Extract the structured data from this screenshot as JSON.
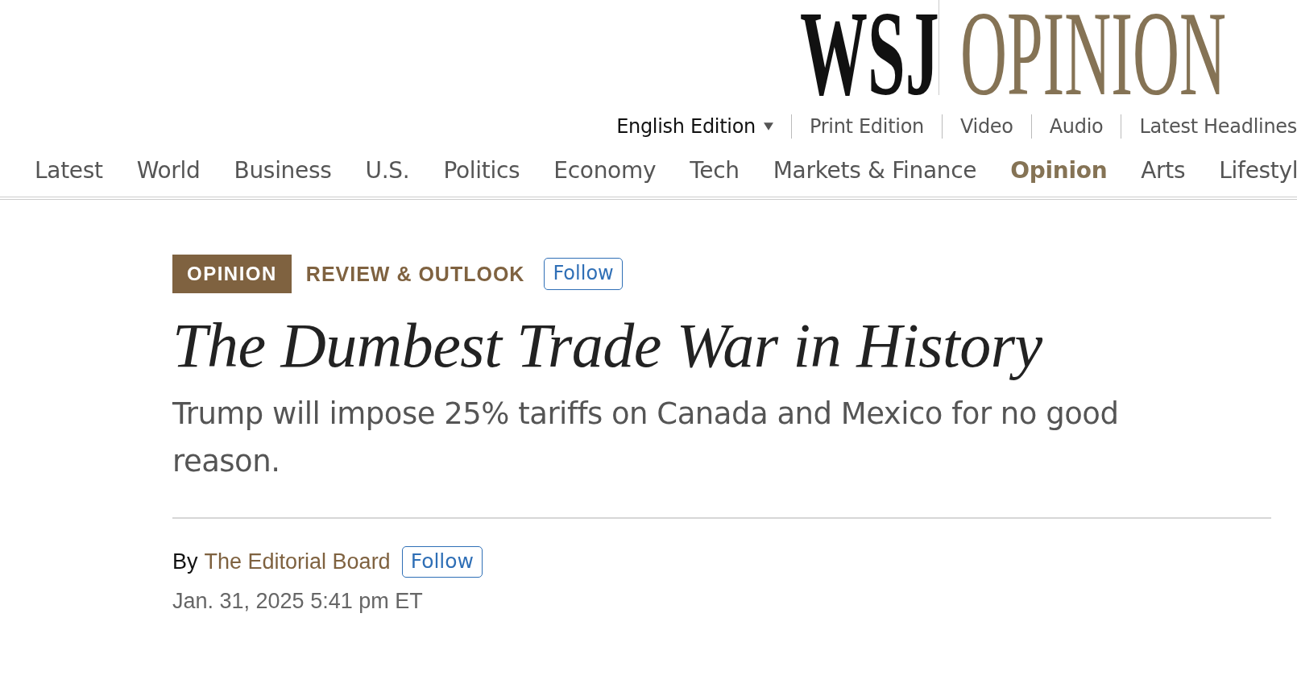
{
  "masthead": {
    "brand": "WSJ",
    "section": "OPINION"
  },
  "edition_links": [
    {
      "label": "English Edition",
      "kind": "dropdown"
    },
    {
      "label": "Print Edition",
      "kind": "link"
    },
    {
      "label": "Video",
      "kind": "link"
    },
    {
      "label": "Audio",
      "kind": "link"
    },
    {
      "label": "Latest Headlines",
      "kind": "link"
    }
  ],
  "nav": [
    {
      "label": "Latest",
      "selected": false
    },
    {
      "label": "World",
      "selected": false
    },
    {
      "label": "Business",
      "selected": false
    },
    {
      "label": "U.S.",
      "selected": false
    },
    {
      "label": "Politics",
      "selected": false
    },
    {
      "label": "Economy",
      "selected": false
    },
    {
      "label": "Tech",
      "selected": false
    },
    {
      "label": "Markets & Finance",
      "selected": false
    },
    {
      "label": "Opinion",
      "selected": true
    },
    {
      "label": "Arts",
      "selected": false
    },
    {
      "label": "Lifestyl",
      "selected": false
    }
  ],
  "article": {
    "section_tag": "OPINION",
    "column": "REVIEW & OUTLOOK",
    "column_follow": "Follow",
    "headline": "The Dumbest Trade War in History",
    "dek": "Trump will impose 25% tariffs on Canada and Mexico for no good reason.",
    "byline": {
      "prefix": "By",
      "author": "The Editorial Board",
      "follow": "Follow"
    },
    "date": "Jan. 31, 2025 5:41 pm ET"
  }
}
